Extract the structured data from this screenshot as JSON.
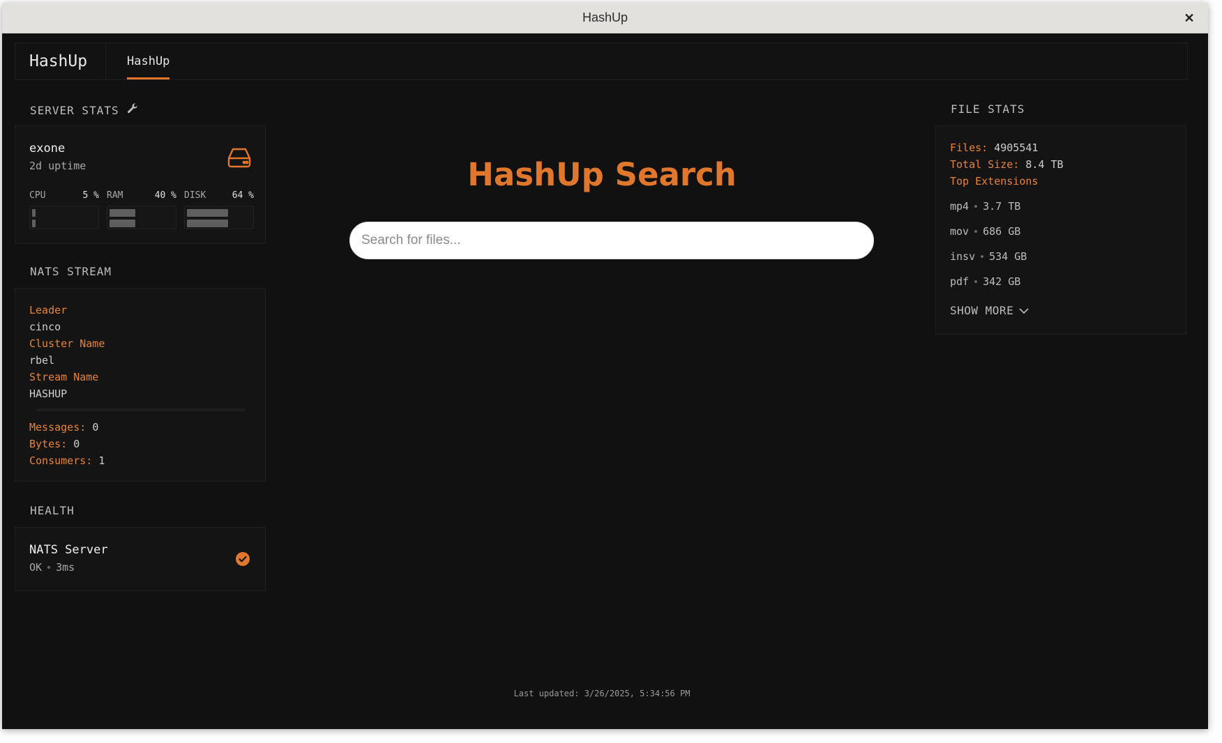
{
  "window": {
    "title": "HashUp",
    "close_label": "✕"
  },
  "appbar": {
    "brand": "HashUp",
    "tab": "HashUp"
  },
  "server_stats": {
    "title": "SERVER STATS",
    "name": "exone",
    "uptime": "2d uptime",
    "meters": [
      {
        "label": "CPU",
        "value": "5",
        "unit": "%",
        "fill": 0.05
      },
      {
        "label": "RAM",
        "value": "40",
        "unit": "%",
        "fill": 0.4
      },
      {
        "label": "DISK",
        "value": "64",
        "unit": "%",
        "fill": 0.64
      }
    ],
    "icons": {
      "settings": "wrench-icon",
      "drive": "hard-drive-icon"
    }
  },
  "nats_stream": {
    "title": "NATS STREAM",
    "leader_label": "Leader",
    "leader_value": "cinco",
    "cluster_label": "Cluster Name",
    "cluster_value": "rbel",
    "stream_label": "Stream Name",
    "stream_value": "HASHUP",
    "messages_label": "Messages:",
    "messages_value": "0",
    "bytes_label": "Bytes:",
    "bytes_value": "0",
    "consumers_label": "Consumers:",
    "consumers_value": "1"
  },
  "health": {
    "title": "HEALTH",
    "service": "NATS Server",
    "status": "OK",
    "latency": "3ms",
    "icon": "check-circle-icon"
  },
  "search": {
    "title": "HashUp Search",
    "placeholder": "Search for files..."
  },
  "file_stats": {
    "title": "FILE STATS",
    "files_label": "Files:",
    "files_value": "4905541",
    "size_label": "Total Size:",
    "size_value": "8.4 TB",
    "top_ext_label": "Top Extensions",
    "extensions": [
      {
        "ext": "mp4",
        "size": "3.7 TB"
      },
      {
        "ext": "mov",
        "size": "686 GB"
      },
      {
        "ext": "insv",
        "size": "534 GB"
      },
      {
        "ext": "pdf",
        "size": "342 GB"
      }
    ],
    "show_more": "SHOW MORE"
  },
  "footer": {
    "last_updated": "Last updated: 3/26/2025, 5:34:56 PM"
  },
  "colors": {
    "accent": "#e0772d",
    "background": "#111111"
  }
}
